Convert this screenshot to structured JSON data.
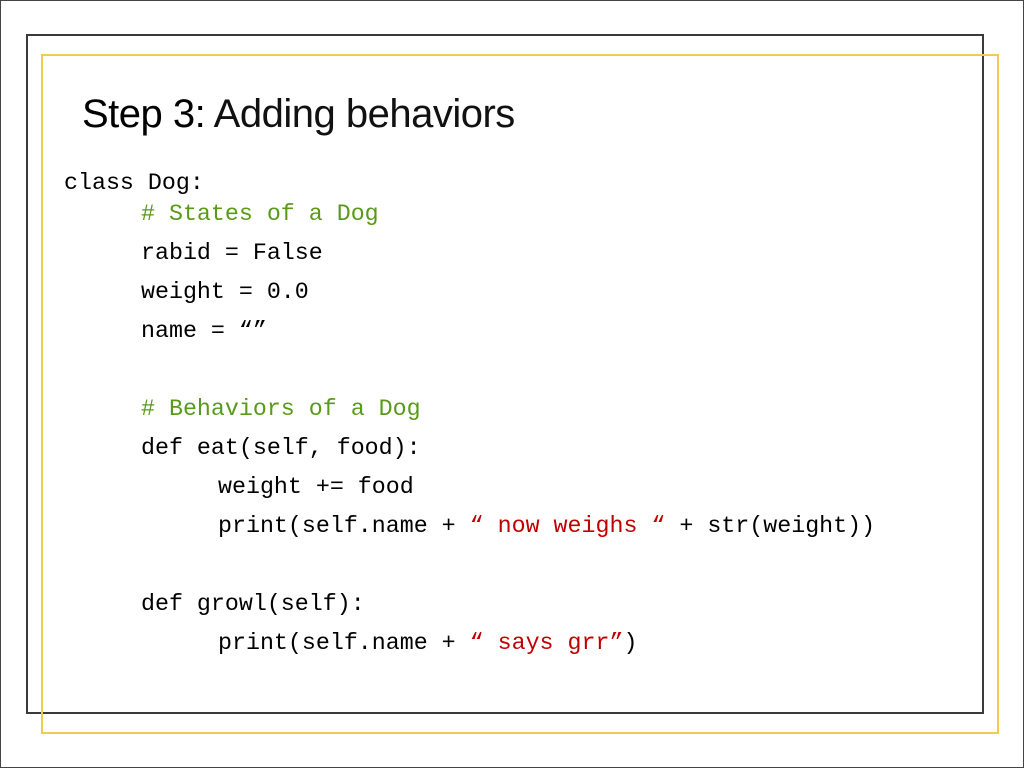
{
  "title": {
    "prefix": "Step 3:",
    "text": " Adding behaviors"
  },
  "colors": {
    "comment": "#5a9a1a",
    "string": "#c00000",
    "accent_frame": "#f3c94e",
    "frame": "#3a3a3a"
  },
  "code": {
    "class_decl": "class Dog:",
    "comment_states": "# States of a Dog",
    "rabid": "rabid = False",
    "weight": "weight = 0.0",
    "name": "name = “”",
    "comment_behaviors": "# Behaviors of a Dog",
    "def_eat": "def eat(self, food):",
    "weight_inc": "weight += food",
    "print_eat_pre": "print(self.name + ",
    "print_eat_str": "“ now weighs “",
    "print_eat_post": " + str(weight))",
    "def_growl": "def growl(self):",
    "print_growl_pre": "print(self.name + ",
    "print_growl_str": "“ says grr”",
    "print_growl_post": ")"
  }
}
